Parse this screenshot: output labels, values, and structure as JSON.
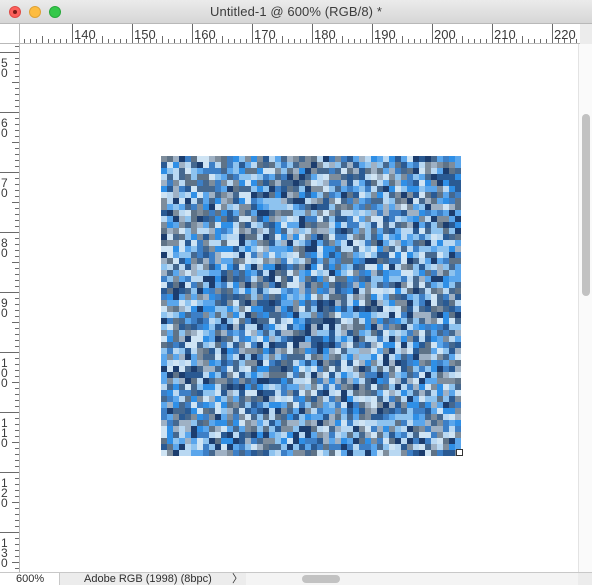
{
  "window": {
    "title": "Untitled-1 @ 600% (RGB/8) *"
  },
  "ruler_h": {
    "labels": [
      "140",
      "150",
      "160",
      "170",
      "180",
      "190",
      "200",
      "210",
      "220"
    ]
  },
  "ruler_v": {
    "labels": [
      "5\n0",
      "6\n0",
      "7\n0",
      "8\n0",
      "9\n0",
      "1\n0\n0",
      "1\n1\n0",
      "1\n2\n0",
      "1\n3\n0"
    ]
  },
  "document": {
    "description_icon": "pixel-noise-canvas",
    "palette": [
      "#1c3d6e",
      "#2a5a93",
      "#3d7fc6",
      "#2f8fe6",
      "#5aa6ec",
      "#8ec3ef",
      "#b9d8f2",
      "#cfe4f4",
      "#5f7387",
      "#7e8d9c",
      "#9fb1c4",
      "#45688f"
    ]
  },
  "status": {
    "zoom": "600%",
    "profile": "Adobe RGB (1998) (8bpc)",
    "chevron": "〉"
  }
}
